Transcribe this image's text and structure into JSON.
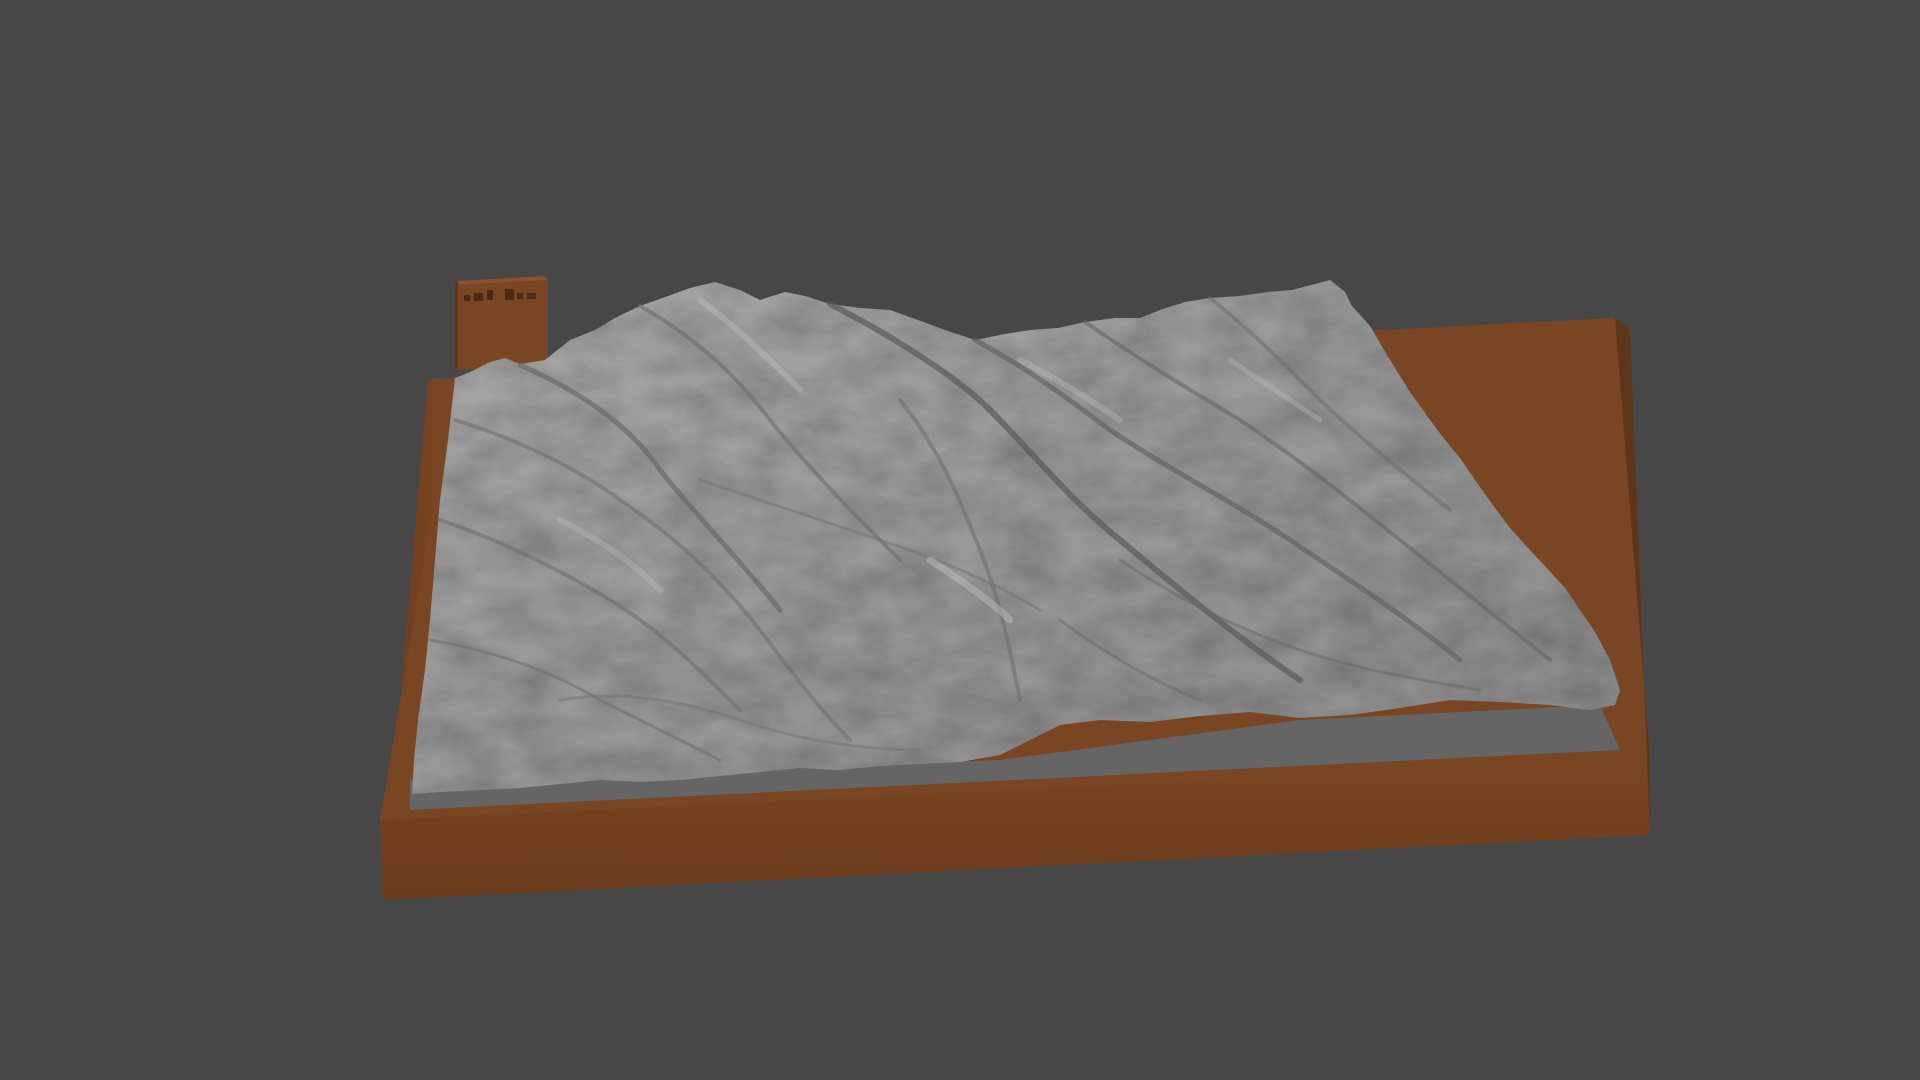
{
  "viewport": {
    "background_color": "#474747"
  },
  "model": {
    "type": "terrain-relief-3d-model",
    "base_color": "#6e3f1f",
    "base_front_color": "#6a3c1e",
    "base_top_color": "#7a4522",
    "terrain_color": "#9c9c9c",
    "terrain_shadow_color": "#5c5c5c",
    "terrain_highlight_color": "#cfcfcf",
    "flat_area_color": "#656565",
    "label_block_color": "#7a4522",
    "label_block_engraving": "logo-mark"
  }
}
